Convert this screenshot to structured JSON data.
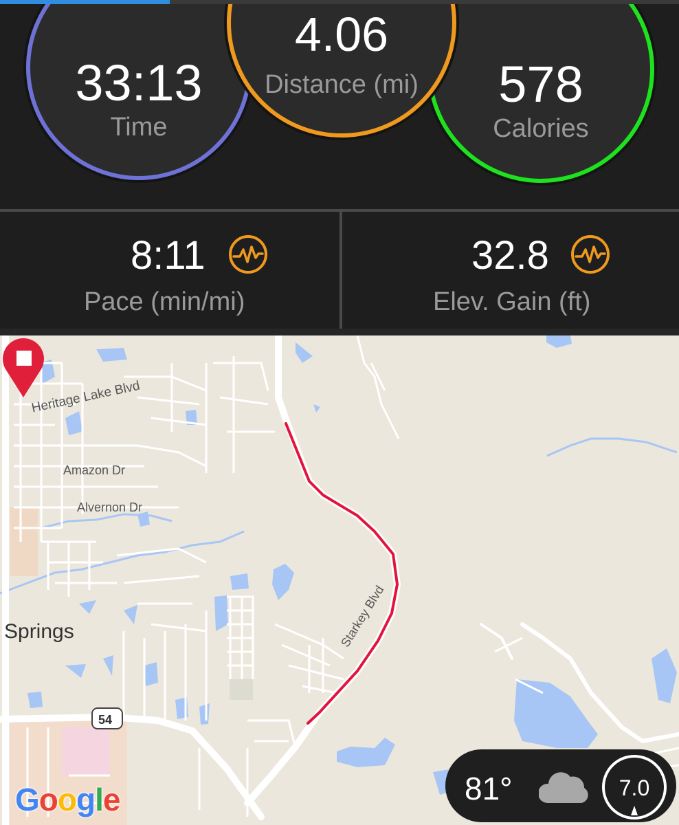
{
  "progress": {
    "fraction": 0.25,
    "color": "#2f8ee0"
  },
  "rings": {
    "time": {
      "value": "33:13",
      "label": "Time",
      "color": "#6e72d6"
    },
    "distance": {
      "value": "4.06",
      "label": "Distance (mi)",
      "color": "#ef9a1e"
    },
    "calories": {
      "value": "578",
      "label": "Calories",
      "color": "#1ee21e"
    }
  },
  "cells": {
    "pace": {
      "value": "8:11",
      "label": "Pace (min/mi)",
      "icon": "pulse-icon"
    },
    "elev": {
      "value": "32.8",
      "label": "Elev. Gain (ft)",
      "icon": "pulse-icon"
    }
  },
  "map": {
    "labels": {
      "heritage": "Heritage Lake Blvd",
      "amazon": "Amazon Dr",
      "alvernon": "Alvernon Dr",
      "starkey": "Starkey Blvd",
      "springs": "Springs",
      "route54": "54"
    },
    "route_color": "#e3143c",
    "attribution": "Google"
  },
  "weather": {
    "temperature": "81°",
    "condition_icon": "cloud-icon",
    "wind_speed": "7.0"
  }
}
